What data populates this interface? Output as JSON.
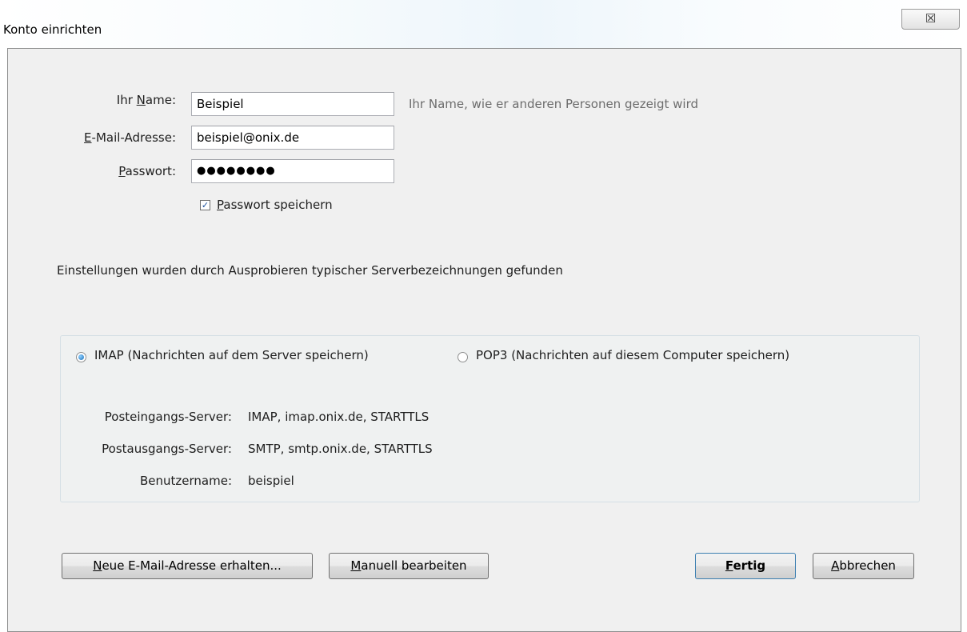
{
  "window": {
    "title": "Konto einrichten",
    "close_icon_glyph": "☒"
  },
  "form": {
    "name_label_pre": "Ihr ",
    "name_label_acc": "N",
    "name_label_post": "ame:",
    "name_value": "Beispiel",
    "name_hint": "Ihr Name, wie er anderen Personen gezeigt wird",
    "email_label_acc": "E",
    "email_label_post": "-Mail-Adresse:",
    "email_value": "beispiel@onix.de",
    "password_label_acc": "P",
    "password_label_post": "asswort:",
    "password_value": "●●●●●●●●",
    "remember_checked_glyph": "✓",
    "remember_label_acc": "P",
    "remember_label_post": "asswort speichern"
  },
  "status_text": "Einstellungen wurden durch Ausprobieren typischer Serverbezeichnungen gefunden",
  "protocol": {
    "imap_label": "IMAP (Nachrichten auf dem Server speichern)",
    "pop3_label": "POP3 (Nachrichten auf diesem Computer speichern)",
    "selected": "IMAP"
  },
  "server_info": {
    "incoming_label": "Posteingangs-Server:",
    "incoming_value": "IMAP, imap.onix.de, STARTTLS",
    "outgoing_label": "Postausgangs-Server:",
    "outgoing_value": "SMTP, smtp.onix.de, STARTTLS",
    "username_label": "Benutzername:",
    "username_value": "beispiel"
  },
  "buttons": {
    "new_address_acc": "N",
    "new_address_post": "eue E-Mail-Adresse erhalten...",
    "manual_acc": "M",
    "manual_post": "anuell bearbeiten",
    "done_acc": "F",
    "done_post": "ertig",
    "cancel_acc": "A",
    "cancel_post": "bbrechen"
  }
}
